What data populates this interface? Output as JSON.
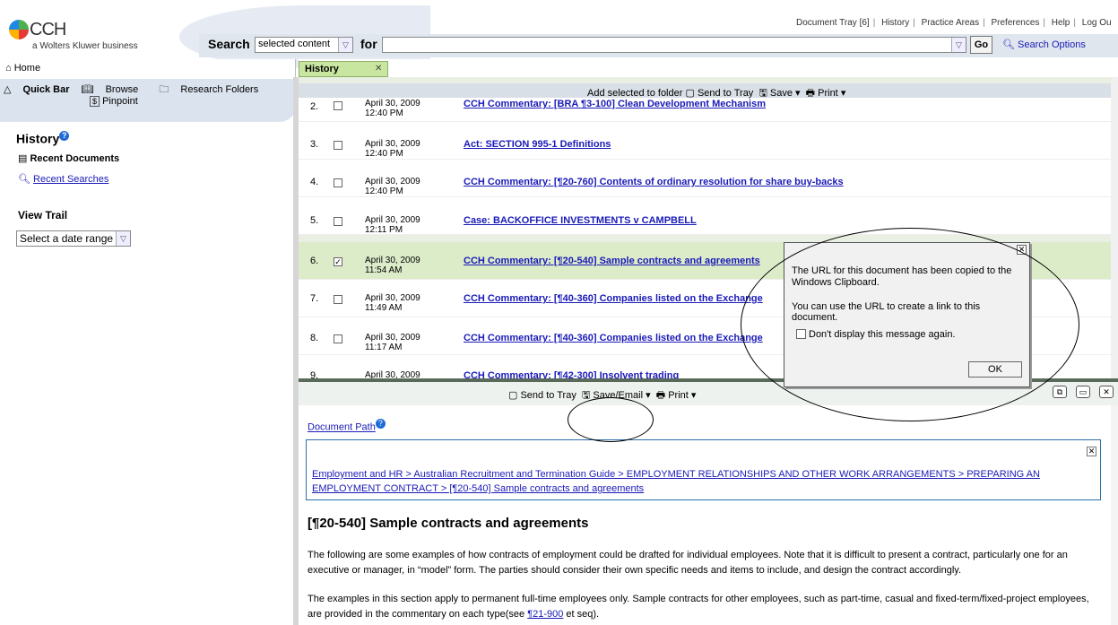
{
  "header": {
    "logo_text": "CCH",
    "logo_sub": "a Wolters Kluwer business",
    "top_links": [
      "Document Tray [6]",
      "History",
      "Practice Areas",
      "Preferences",
      "Help",
      "Log Ou"
    ],
    "search_label": "Search",
    "scope_value": "selected content",
    "for_label": "for",
    "search_value": "",
    "go_label": "Go",
    "search_options": "Search Options"
  },
  "left": {
    "home": "Home",
    "quickbar": "Quick Bar",
    "browse": "Browse",
    "research_folders": "Research Folders",
    "pinpoint": "Pinpoint",
    "history_title": "History",
    "recent_documents": "Recent Documents",
    "recent_searches": "Recent Searches",
    "view_trail": "View Trail",
    "date_select": "Select a date range"
  },
  "history": {
    "tab_label": "History",
    "toolbar": "Add selected to folder",
    "send_to_tray": "Send to Tray",
    "save": "Save",
    "print": "Print",
    "rows": [
      {
        "num": "2.",
        "date": "April 30, 2009",
        "time": "12:40 PM",
        "title": "CCH Commentary: [BRA ¶3-100] Clean Development Mechanism",
        "checked": ""
      },
      {
        "num": "3.",
        "date": "April 30, 2009",
        "time": "12:40 PM",
        "title": "Act: SECTION 995-1 Definitions",
        "checked": ""
      },
      {
        "num": "4.",
        "date": "April 30, 2009",
        "time": "12:40 PM",
        "title": "CCH Commentary: [¶20-760] Contents of ordinary resolution for share buy-backs",
        "checked": ""
      },
      {
        "num": "5.",
        "date": "April 30, 2009",
        "time": "12:11 PM",
        "title": "Case: BACKOFFICE INVESTMENTS v CAMPBELL",
        "checked": ""
      },
      {
        "num": "6.",
        "date": "April 30, 2009",
        "time": "11:54 AM",
        "title": "CCH Commentary: [¶20-540] Sample contracts and agreements",
        "checked": "✓"
      },
      {
        "num": "7.",
        "date": "April 30, 2009",
        "time": "11:49 AM",
        "title": "CCH Commentary: [¶40-360] Companies listed on the Exchange",
        "checked": ""
      },
      {
        "num": "8.",
        "date": "April 30, 2009",
        "time": "11:17 AM",
        "title": "CCH Commentary: [¶40-360] Companies listed on the Exchange",
        "checked": ""
      },
      {
        "num": "9.",
        "date": "April 30, 2009",
        "time": "",
        "title": "CCH Commentary: [¶42-300] Insolvent trading",
        "checked": ""
      }
    ]
  },
  "doc": {
    "send_to_tray": "Send to Tray",
    "save_email": "Save/Email",
    "print": "Print",
    "document_path": "Document Path",
    "breadcrumb": "Employment and HR > Australian Recruitment and Termination Guide > EMPLOYMENT RELATIONSHIPS AND OTHER WORK ARRANGEMENTS > PREPARING AN EMPLOYMENT CONTRACT > [¶20-540] Sample contracts and agreements",
    "title": "[¶20-540] Sample contracts and agreements",
    "para1": "The following are some examples of how contracts of employment could be drafted for individual employees. Note that it is difficult to present a contract, particularly one for an executive or manager, in “model” form. The parties should consider their own specific needs and items to include, and design the contract accordingly.",
    "para2_start": "The examples in this section apply to permanent full-time employees only. Sample contracts for other employees, such as part-time, casual and fixed-term/fixed-project employees, are provided in the commentary on each type(see ",
    "para2_link": "¶21-900",
    "para2_end": " et seq)."
  },
  "dialog": {
    "msg1": "The URL for this document has been copied to the Windows Clipboard.",
    "msg2": "You can use the URL to create a link to this document.",
    "checkbox_label": "Don't display this message again.",
    "ok": "OK"
  }
}
